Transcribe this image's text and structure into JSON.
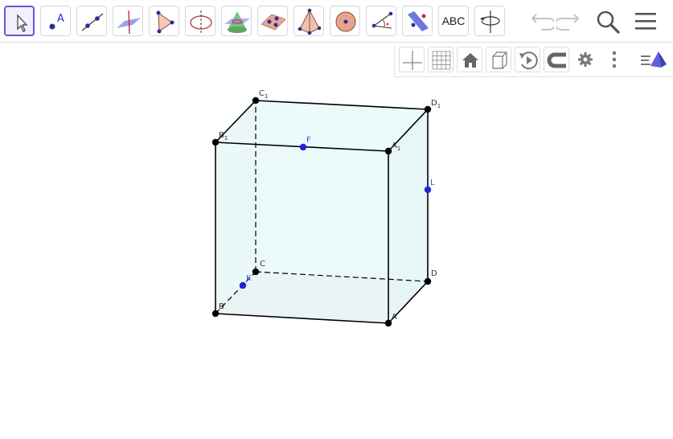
{
  "toolbar": {
    "tools": [
      {
        "name": "move-tool",
        "label": ""
      },
      {
        "name": "point-tool",
        "label": "A"
      },
      {
        "name": "line-tool",
        "label": ""
      },
      {
        "name": "perpendicular-tool",
        "label": ""
      },
      {
        "name": "polygon-tool",
        "label": ""
      },
      {
        "name": "circle-axis-tool",
        "label": ""
      },
      {
        "name": "intersect-surfaces-tool",
        "label": ""
      },
      {
        "name": "plane-tool",
        "label": ""
      },
      {
        "name": "pyramid-tool",
        "label": ""
      },
      {
        "name": "sphere-tool",
        "label": ""
      },
      {
        "name": "angle-tool",
        "label": ""
      },
      {
        "name": "reflect-tool",
        "label": ""
      },
      {
        "name": "text-tool",
        "label": "ABC"
      },
      {
        "name": "rotate-view-tool",
        "label": ""
      }
    ],
    "undo_icon": "undo-icon",
    "redo_icon": "redo-icon",
    "search_icon": "search-icon",
    "menu_icon": "menu-icon"
  },
  "style_bar": {
    "buttons": [
      "axes-icon",
      "grid-icon",
      "home-icon",
      "cube-view-icon",
      "rotate-icon",
      "magnet-icon",
      "gear-icon",
      "more-icon",
      "view-toggle-icon"
    ]
  },
  "points": {
    "A": {
      "main": "A",
      "sub": ""
    },
    "B": {
      "main": "B",
      "sub": ""
    },
    "C": {
      "main": "C",
      "sub": ""
    },
    "D": {
      "main": "D",
      "sub": ""
    },
    "A1": {
      "main": "A",
      "sub": "1"
    },
    "B1": {
      "main": "B",
      "sub": "1"
    },
    "C1": {
      "main": "C",
      "sub": "1"
    },
    "D1": {
      "main": "D",
      "sub": "1"
    },
    "F": {
      "main": "F",
      "sub": ""
    },
    "L": {
      "main": "L",
      "sub": ""
    },
    "K": {
      "main": "K",
      "sub": ""
    }
  },
  "colors": {
    "accent": "#6557d2",
    "face_fill": "#e8f8f8",
    "bottom_fill": "#e6ebeb",
    "edge": "#000000",
    "point": "#000000",
    "blue_point": "#2323d6"
  }
}
